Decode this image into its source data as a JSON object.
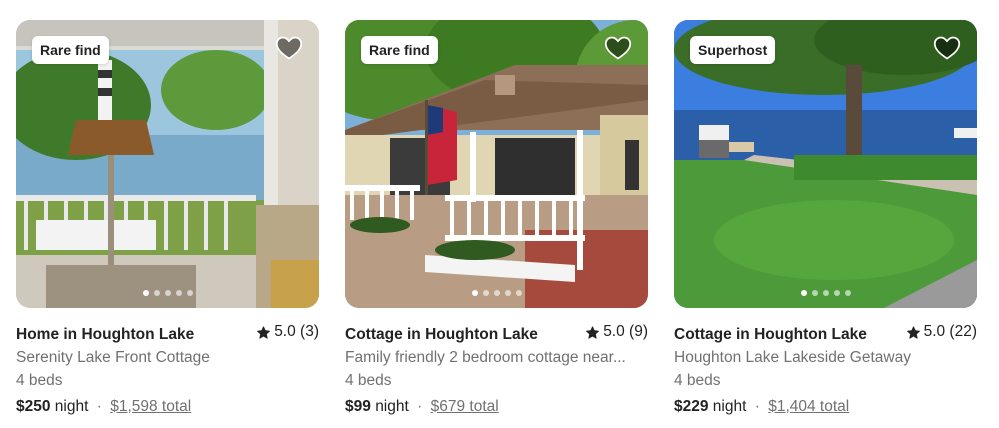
{
  "listings": [
    {
      "badge": "Rare find",
      "title": "Home in Houghton Lake",
      "rating": "5.0 (3)",
      "subtitle": "Serenity Lake Front Cottage",
      "beds": "4 beds",
      "price": "$250",
      "night_label": "night",
      "separator": "·",
      "total": "$1,598 total",
      "photo_count": 5,
      "active_photo": 1
    },
    {
      "badge": "Rare find",
      "title": "Cottage in Houghton Lake",
      "rating": "5.0 (9)",
      "subtitle": "Family friendly 2 bedroom cottage near...",
      "beds": "4 beds",
      "price": "$99",
      "night_label": "night",
      "separator": "·",
      "total": "$679 total",
      "photo_count": 5,
      "active_photo": 1
    },
    {
      "badge": "Superhost",
      "title": "Cottage in Houghton Lake",
      "rating": "5.0 (22)",
      "subtitle": "Houghton Lake Lakeside Getaway",
      "beds": "4 beds",
      "price": "$229",
      "night_label": "night",
      "separator": "·",
      "total": "$1,404 total",
      "photo_count": 5,
      "active_photo": 1
    }
  ],
  "icons": {
    "heart": "heart-icon",
    "star": "star-icon"
  },
  "colors": {
    "text_primary": "#222222",
    "text_secondary": "#717171",
    "badge_bg": "#ffffff"
  }
}
